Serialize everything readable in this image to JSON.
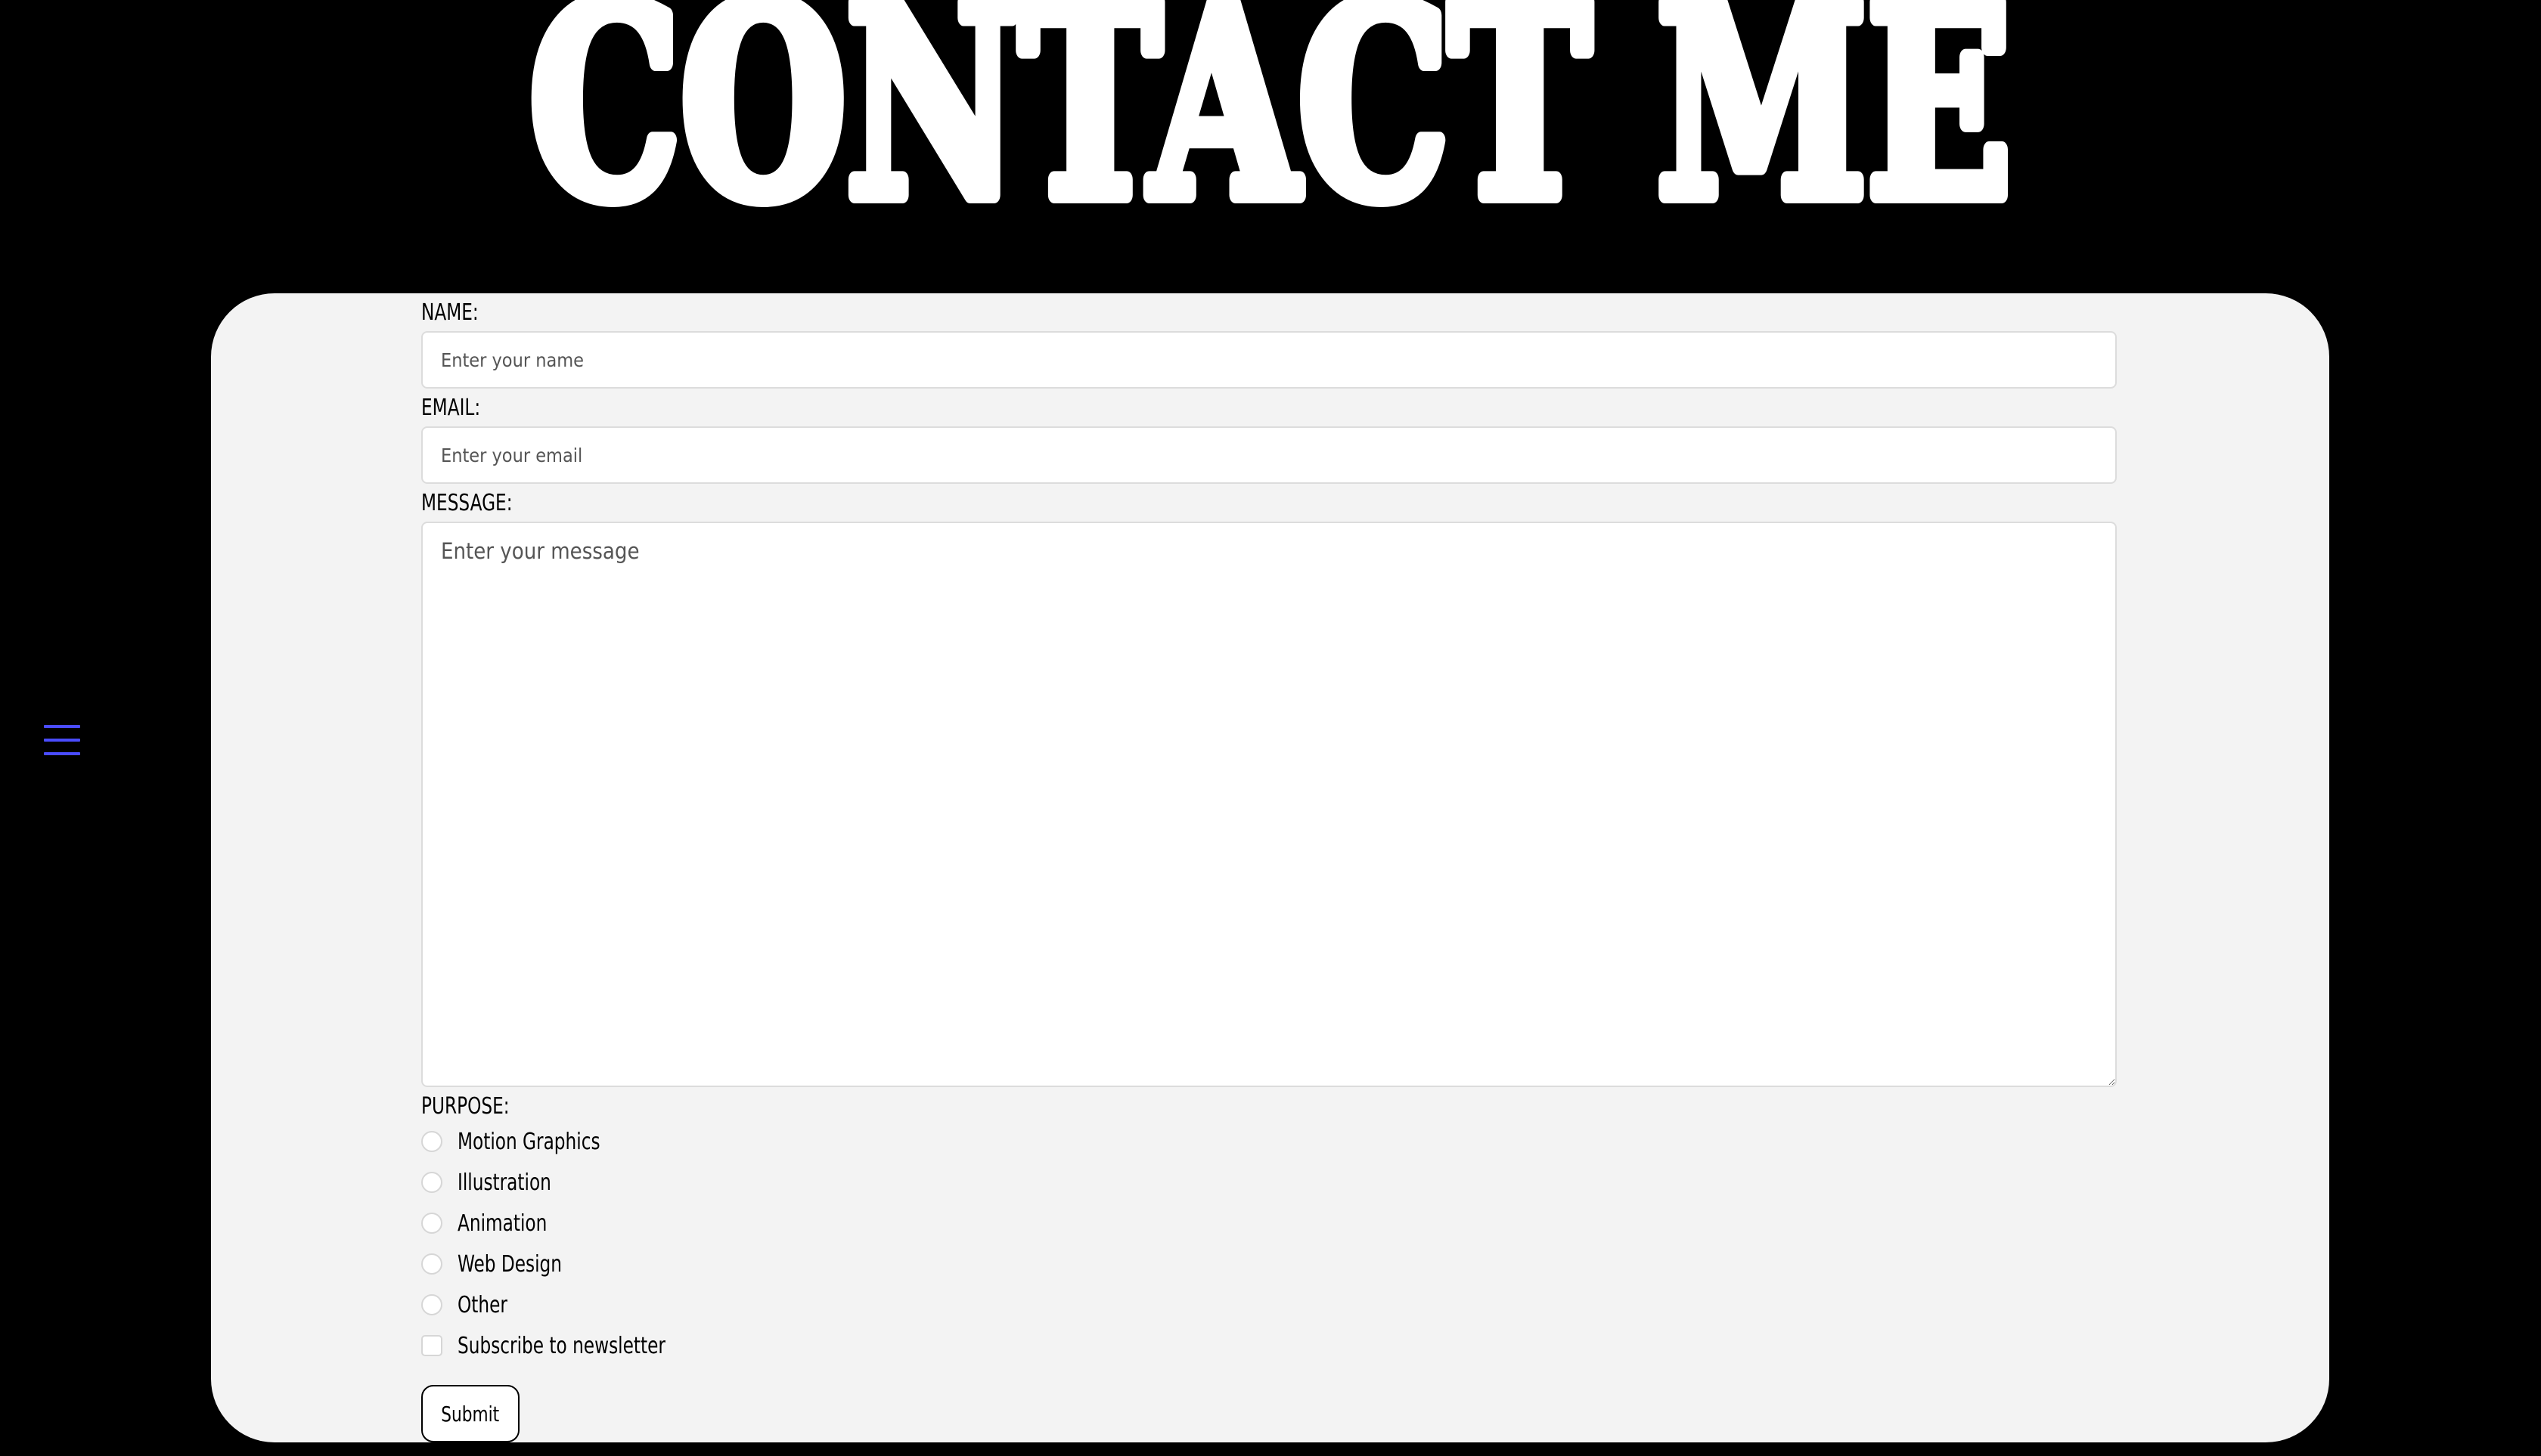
{
  "page": {
    "title": "CONTACT ME"
  },
  "menu": {
    "icon": "hamburger-menu-icon",
    "color": "#4a4cff"
  },
  "form": {
    "name": {
      "label": "NAME:",
      "placeholder": "Enter your name",
      "value": ""
    },
    "email": {
      "label": "EMAIL:",
      "placeholder": "Enter your email",
      "value": ""
    },
    "message": {
      "label": "MESSAGE:",
      "placeholder": "Enter your message",
      "value": ""
    },
    "purpose": {
      "label": "PURPOSE:",
      "options": [
        "Motion Graphics",
        "Illustration",
        "Animation",
        "Web Design",
        "Other"
      ],
      "selected": null
    },
    "newsletter": {
      "label": "Subscribe to newsletter",
      "checked": false
    },
    "submit_label": "Submit"
  },
  "colors": {
    "background": "#000000",
    "card": "#f3f3f3",
    "title": "#ffffff",
    "accent": "#4a4cff"
  }
}
